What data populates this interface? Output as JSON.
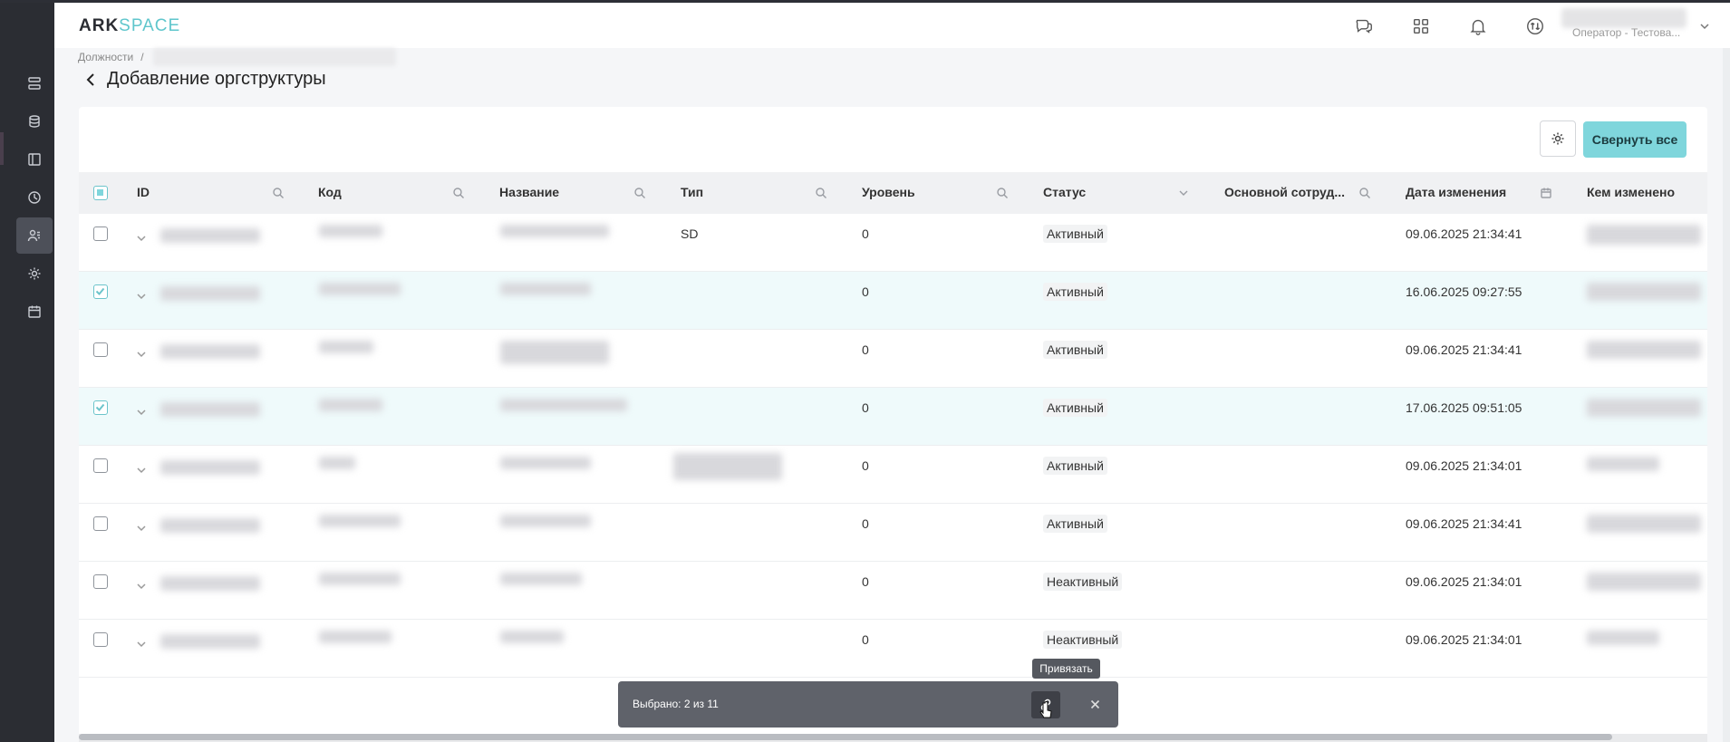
{
  "header": {
    "logo_part1": "ARK",
    "logo_part2": "SPACE",
    "user_role": "Оператор - Тестова..."
  },
  "breadcrumb": {
    "parent": "Должности",
    "separator": "/"
  },
  "page": {
    "title": "Добавление оргструктуры"
  },
  "toolbar": {
    "collapse_label": "Свернуть все"
  },
  "table": {
    "columns": [
      "ID",
      "Код",
      "Название",
      "Тип",
      "Уровень",
      "Статус",
      "Основной сотруд...",
      "Дата изменения",
      "Кем изменено"
    ],
    "rows": [
      {
        "type": "SD",
        "level": "0",
        "status": "Активный",
        "date": "09.06.2025 21:34:41",
        "selected": false
      },
      {
        "type": "",
        "level": "0",
        "status": "Активный",
        "date": "16.06.2025 09:27:55",
        "selected": true
      },
      {
        "type": "",
        "level": "0",
        "status": "Активный",
        "date": "09.06.2025 21:34:41",
        "selected": false
      },
      {
        "type": "",
        "level": "0",
        "status": "Активный",
        "date": "17.06.2025 09:51:05",
        "selected": true
      },
      {
        "type": "",
        "level": "0",
        "status": "Активный",
        "date": "09.06.2025 21:34:01",
        "selected": false
      },
      {
        "type": "",
        "level": "0",
        "status": "Активный",
        "date": "09.06.2025 21:34:41",
        "selected": false
      },
      {
        "type": "",
        "level": "0",
        "status": "Неактивный",
        "date": "09.06.2025 21:34:01",
        "selected": false
      },
      {
        "type": "",
        "level": "0",
        "status": "Неактивный",
        "date": "09.06.2025 21:34:01",
        "selected": false
      }
    ]
  },
  "action_bar": {
    "selected_text": "Выбрано: 2 из 11",
    "tooltip": "Привязать"
  },
  "colors": {
    "accent": "#7fd6dc",
    "sidebar": "#2b2d33"
  }
}
